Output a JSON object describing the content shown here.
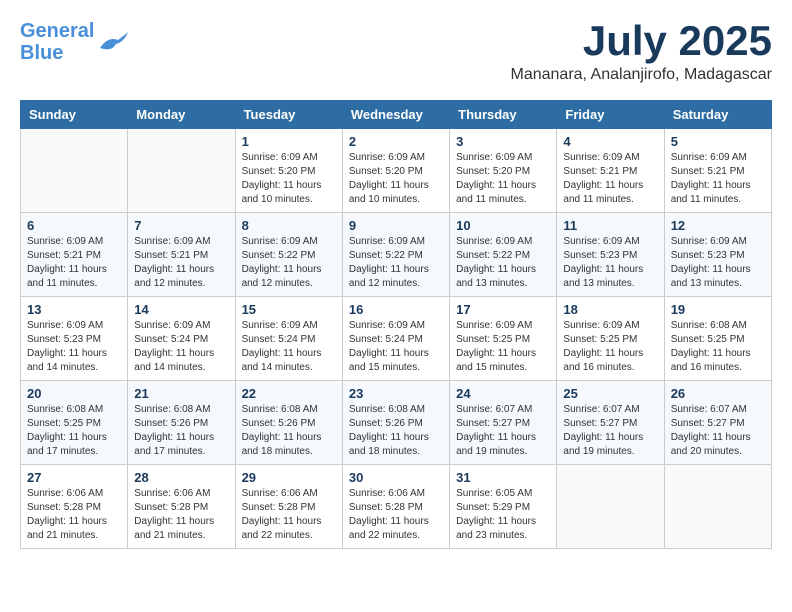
{
  "header": {
    "logo_line1": "General",
    "logo_line2": "Blue",
    "title": "July 2025",
    "subtitle": "Mananara, Analanjirofo, Madagascar"
  },
  "weekdays": [
    "Sunday",
    "Monday",
    "Tuesday",
    "Wednesday",
    "Thursday",
    "Friday",
    "Saturday"
  ],
  "weeks": [
    [
      {
        "day": "",
        "sunrise": "",
        "sunset": "",
        "daylight": ""
      },
      {
        "day": "",
        "sunrise": "",
        "sunset": "",
        "daylight": ""
      },
      {
        "day": "1",
        "sunrise": "Sunrise: 6:09 AM",
        "sunset": "Sunset: 5:20 PM",
        "daylight": "Daylight: 11 hours and 10 minutes."
      },
      {
        "day": "2",
        "sunrise": "Sunrise: 6:09 AM",
        "sunset": "Sunset: 5:20 PM",
        "daylight": "Daylight: 11 hours and 10 minutes."
      },
      {
        "day": "3",
        "sunrise": "Sunrise: 6:09 AM",
        "sunset": "Sunset: 5:20 PM",
        "daylight": "Daylight: 11 hours and 11 minutes."
      },
      {
        "day": "4",
        "sunrise": "Sunrise: 6:09 AM",
        "sunset": "Sunset: 5:21 PM",
        "daylight": "Daylight: 11 hours and 11 minutes."
      },
      {
        "day": "5",
        "sunrise": "Sunrise: 6:09 AM",
        "sunset": "Sunset: 5:21 PM",
        "daylight": "Daylight: 11 hours and 11 minutes."
      }
    ],
    [
      {
        "day": "6",
        "sunrise": "Sunrise: 6:09 AM",
        "sunset": "Sunset: 5:21 PM",
        "daylight": "Daylight: 11 hours and 11 minutes."
      },
      {
        "day": "7",
        "sunrise": "Sunrise: 6:09 AM",
        "sunset": "Sunset: 5:21 PM",
        "daylight": "Daylight: 11 hours and 12 minutes."
      },
      {
        "day": "8",
        "sunrise": "Sunrise: 6:09 AM",
        "sunset": "Sunset: 5:22 PM",
        "daylight": "Daylight: 11 hours and 12 minutes."
      },
      {
        "day": "9",
        "sunrise": "Sunrise: 6:09 AM",
        "sunset": "Sunset: 5:22 PM",
        "daylight": "Daylight: 11 hours and 12 minutes."
      },
      {
        "day": "10",
        "sunrise": "Sunrise: 6:09 AM",
        "sunset": "Sunset: 5:22 PM",
        "daylight": "Daylight: 11 hours and 13 minutes."
      },
      {
        "day": "11",
        "sunrise": "Sunrise: 6:09 AM",
        "sunset": "Sunset: 5:23 PM",
        "daylight": "Daylight: 11 hours and 13 minutes."
      },
      {
        "day": "12",
        "sunrise": "Sunrise: 6:09 AM",
        "sunset": "Sunset: 5:23 PM",
        "daylight": "Daylight: 11 hours and 13 minutes."
      }
    ],
    [
      {
        "day": "13",
        "sunrise": "Sunrise: 6:09 AM",
        "sunset": "Sunset: 5:23 PM",
        "daylight": "Daylight: 11 hours and 14 minutes."
      },
      {
        "day": "14",
        "sunrise": "Sunrise: 6:09 AM",
        "sunset": "Sunset: 5:24 PM",
        "daylight": "Daylight: 11 hours and 14 minutes."
      },
      {
        "day": "15",
        "sunrise": "Sunrise: 6:09 AM",
        "sunset": "Sunset: 5:24 PM",
        "daylight": "Daylight: 11 hours and 14 minutes."
      },
      {
        "day": "16",
        "sunrise": "Sunrise: 6:09 AM",
        "sunset": "Sunset: 5:24 PM",
        "daylight": "Daylight: 11 hours and 15 minutes."
      },
      {
        "day": "17",
        "sunrise": "Sunrise: 6:09 AM",
        "sunset": "Sunset: 5:25 PM",
        "daylight": "Daylight: 11 hours and 15 minutes."
      },
      {
        "day": "18",
        "sunrise": "Sunrise: 6:09 AM",
        "sunset": "Sunset: 5:25 PM",
        "daylight": "Daylight: 11 hours and 16 minutes."
      },
      {
        "day": "19",
        "sunrise": "Sunrise: 6:08 AM",
        "sunset": "Sunset: 5:25 PM",
        "daylight": "Daylight: 11 hours and 16 minutes."
      }
    ],
    [
      {
        "day": "20",
        "sunrise": "Sunrise: 6:08 AM",
        "sunset": "Sunset: 5:25 PM",
        "daylight": "Daylight: 11 hours and 17 minutes."
      },
      {
        "day": "21",
        "sunrise": "Sunrise: 6:08 AM",
        "sunset": "Sunset: 5:26 PM",
        "daylight": "Daylight: 11 hours and 17 minutes."
      },
      {
        "day": "22",
        "sunrise": "Sunrise: 6:08 AM",
        "sunset": "Sunset: 5:26 PM",
        "daylight": "Daylight: 11 hours and 18 minutes."
      },
      {
        "day": "23",
        "sunrise": "Sunrise: 6:08 AM",
        "sunset": "Sunset: 5:26 PM",
        "daylight": "Daylight: 11 hours and 18 minutes."
      },
      {
        "day": "24",
        "sunrise": "Sunrise: 6:07 AM",
        "sunset": "Sunset: 5:27 PM",
        "daylight": "Daylight: 11 hours and 19 minutes."
      },
      {
        "day": "25",
        "sunrise": "Sunrise: 6:07 AM",
        "sunset": "Sunset: 5:27 PM",
        "daylight": "Daylight: 11 hours and 19 minutes."
      },
      {
        "day": "26",
        "sunrise": "Sunrise: 6:07 AM",
        "sunset": "Sunset: 5:27 PM",
        "daylight": "Daylight: 11 hours and 20 minutes."
      }
    ],
    [
      {
        "day": "27",
        "sunrise": "Sunrise: 6:06 AM",
        "sunset": "Sunset: 5:28 PM",
        "daylight": "Daylight: 11 hours and 21 minutes."
      },
      {
        "day": "28",
        "sunrise": "Sunrise: 6:06 AM",
        "sunset": "Sunset: 5:28 PM",
        "daylight": "Daylight: 11 hours and 21 minutes."
      },
      {
        "day": "29",
        "sunrise": "Sunrise: 6:06 AM",
        "sunset": "Sunset: 5:28 PM",
        "daylight": "Daylight: 11 hours and 22 minutes."
      },
      {
        "day": "30",
        "sunrise": "Sunrise: 6:06 AM",
        "sunset": "Sunset: 5:28 PM",
        "daylight": "Daylight: 11 hours and 22 minutes."
      },
      {
        "day": "31",
        "sunrise": "Sunrise: 6:05 AM",
        "sunset": "Sunset: 5:29 PM",
        "daylight": "Daylight: 11 hours and 23 minutes."
      },
      {
        "day": "",
        "sunrise": "",
        "sunset": "",
        "daylight": ""
      },
      {
        "day": "",
        "sunrise": "",
        "sunset": "",
        "daylight": ""
      }
    ]
  ]
}
